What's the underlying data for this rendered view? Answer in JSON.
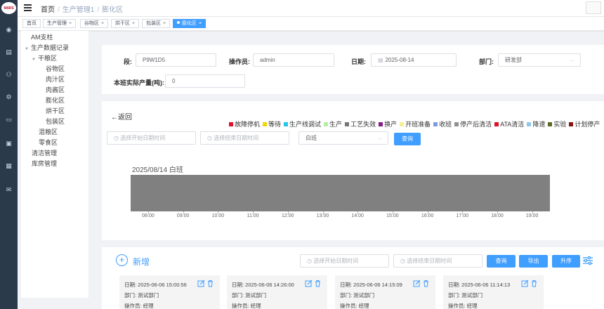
{
  "rail": {
    "logo": "MARS"
  },
  "header": {
    "breadcrumb": [
      "首页",
      "生产管理1",
      "膨化区"
    ]
  },
  "tags": [
    {
      "label": "首页",
      "closable": false
    },
    {
      "label": "生产管理",
      "closable": true
    },
    {
      "label": "谷物区",
      "closable": true
    },
    {
      "label": "烘干区",
      "closable": true
    },
    {
      "label": "包装区",
      "closable": true
    },
    {
      "label": "膨化区",
      "closable": true,
      "active": true
    }
  ],
  "tree": [
    {
      "label": "AM支柱",
      "level": 0
    },
    {
      "label": "生产数据记录",
      "level": 0,
      "expanded": true
    },
    {
      "label": "干粮区",
      "level": 1,
      "expanded": true
    },
    {
      "label": "谷物区",
      "level": 2
    },
    {
      "label": "肉汁区",
      "level": 2
    },
    {
      "label": "肉酱区",
      "level": 2
    },
    {
      "label": "膨化区",
      "level": 2
    },
    {
      "label": "烘干区",
      "level": 2
    },
    {
      "label": "包装区",
      "level": 2
    },
    {
      "label": "混粮区",
      "level": 1
    },
    {
      "label": "零食区",
      "level": 1
    },
    {
      "label": "清洁管理",
      "level": 0
    },
    {
      "label": "库房管理",
      "level": 0
    }
  ],
  "form": {
    "segment_label": "段:",
    "segment_value": "P9W1D5",
    "operator_label": "操作员:",
    "operator_value": "admin",
    "date_label": "日期:",
    "date_value": "2025-08-14",
    "dept_label": "部门:",
    "dept_value": "研发部",
    "output_label": "本班实际产量(吨):",
    "output_value": "0"
  },
  "chart_section": {
    "back": "←返回",
    "start_placeholder": "选择开始日期时间",
    "end_placeholder": "选择结束日期时间",
    "shift_value": "白班",
    "query": "查询"
  },
  "legend": [
    {
      "label": "故障停机",
      "color": "#e0102a"
    },
    {
      "label": "等待",
      "color": "#f0d800"
    },
    {
      "label": "生产线调试",
      "color": "#25c4e8"
    },
    {
      "label": "生产",
      "color": "#b4eea0"
    },
    {
      "label": "工艺失效",
      "color": "#777777"
    },
    {
      "label": "换产",
      "color": "#8a1a8a"
    },
    {
      "label": "开班准备",
      "color": "#f5f090"
    },
    {
      "label": "收班",
      "color": "#7a9ee0"
    },
    {
      "label": "停产后清洁",
      "color": "#909090"
    },
    {
      "label": "ATA清洁",
      "color": "#e0102a"
    },
    {
      "label": "降速",
      "color": "#8ec8e8"
    },
    {
      "label": "实验",
      "color": "#5a6a20"
    },
    {
      "label": "计划停产",
      "color": "#8b1010"
    }
  ],
  "chart_data": {
    "type": "bar",
    "title": "2025/08/14 白班",
    "x_ticks": [
      "08:00",
      "09:00",
      "10:00",
      "11:00",
      "12:00",
      "13:00",
      "14:00",
      "15:00",
      "16:00",
      "17:00",
      "18:00",
      "19:00"
    ],
    "segments": [
      {
        "start": "07:30",
        "end": "19:30",
        "color": "#808080"
      }
    ]
  },
  "records": {
    "add_label": "新增",
    "start_placeholder": "选择开始日期时间",
    "end_placeholder": "选择结束日期时间",
    "query": "查询",
    "export": "导出",
    "sort": "升序",
    "cards": [
      {
        "date": "日期:  2025-06-06 15:00:56",
        "dept": "部门: 测试部门",
        "operator": "操作员: 经理"
      },
      {
        "date": "日期:  2025-06-06 14:26:00",
        "dept": "部门: 测试部门",
        "operator": "操作员: 经理"
      },
      {
        "date": "日期:  2025-06-06 14:15:09",
        "dept": "部门: 测试部门",
        "operator": "操作员: 经理"
      },
      {
        "date": "日期:  2025-06-06 11:14:13",
        "dept": "部门: 测试部门",
        "operator": "操作员: 经理"
      }
    ]
  }
}
